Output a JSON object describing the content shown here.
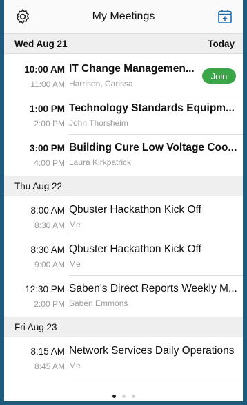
{
  "header": {
    "title": "My Meetings",
    "settings_icon": "gear-icon",
    "add_icon": "calendar-plus-icon",
    "accent": "#1e6fb5"
  },
  "days": [
    {
      "label": "Wed Aug 21",
      "badge": "Today",
      "meetings": [
        {
          "start": "10:00 AM",
          "end": "11:00 AM",
          "subject": "IT Change Management Board",
          "who": "Harrison, Carissa",
          "join": "Join"
        },
        {
          "start": "1:00 PM",
          "end": "2:00 PM",
          "subject": "Technology Standards Equipment Review",
          "who": "John Thorsheim"
        },
        {
          "start": "3:00 PM",
          "end": "4:00 PM",
          "subject": "Building Cure Low Voltage Coordination",
          "who": "Laura Kirkpatrick"
        }
      ]
    },
    {
      "label": "Thu Aug 22",
      "badge": "",
      "meetings": [
        {
          "start": "8:00 AM",
          "end": "8:30 AM",
          "subject": "Qbuster Hackathon Kick Off",
          "who": "Me"
        },
        {
          "start": "8:30 AM",
          "end": "9:00 AM",
          "subject": "Qbuster Hackathon Kick Off",
          "who": "Me"
        },
        {
          "start": "12:30 PM",
          "end": "2:00 PM",
          "subject": "Saben's Direct Reports Weekly Meeting",
          "who": "Saben Emmons"
        }
      ]
    },
    {
      "label": "Fri Aug 23",
      "badge": "",
      "meetings": [
        {
          "start": "8:15 AM",
          "end": "8:45 AM",
          "subject": "Network Services Daily Operations",
          "who": "Me"
        }
      ]
    }
  ],
  "pager": {
    "pages": 3,
    "current": 1
  },
  "colors": {
    "join_green": "#3aa648",
    "frame": "#1e5a7a"
  }
}
